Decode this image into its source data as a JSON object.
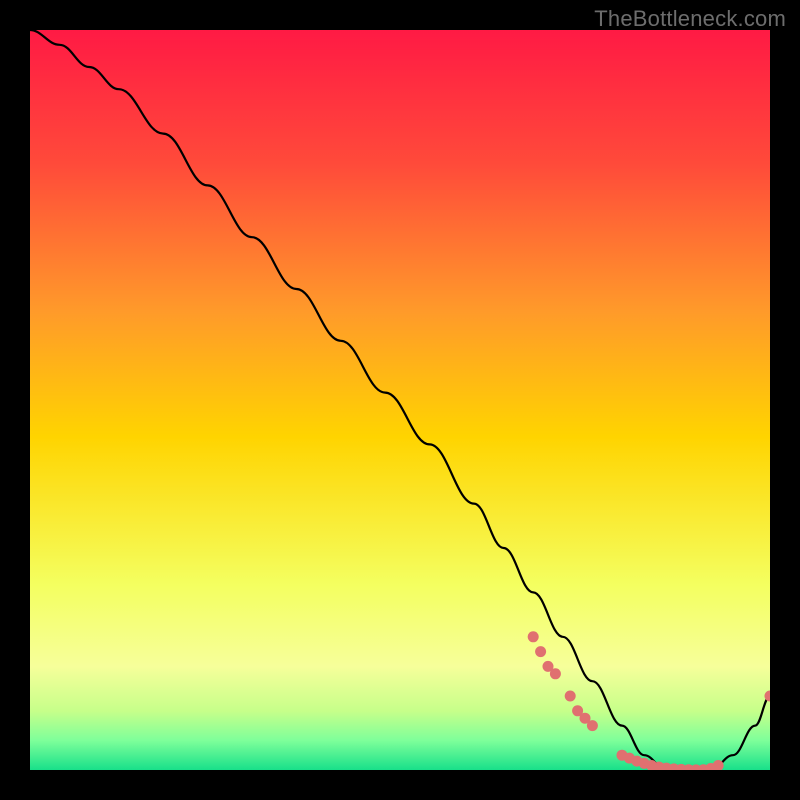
{
  "watermark": "TheBottleneck.com",
  "colors": {
    "curve": "#000000",
    "dot": "#e07070",
    "top": "#ff1a44",
    "mid": "#ffd400",
    "low1": "#f6ff9a",
    "low2": "#7eff9a",
    "bottom": "#18e08a"
  },
  "chart_data": {
    "type": "line",
    "title": "",
    "xlabel": "",
    "ylabel": "",
    "xlim": [
      0,
      100
    ],
    "ylim": [
      0,
      100
    ],
    "grid": false,
    "legend": false,
    "series": [
      {
        "name": "bottleneck-curve",
        "x": [
          0,
          4,
          8,
          12,
          18,
          24,
          30,
          36,
          42,
          48,
          54,
          60,
          64,
          68,
          72,
          76,
          80,
          83,
          86,
          89,
          92,
          95,
          98,
          100
        ],
        "y": [
          100,
          98,
          95,
          92,
          86,
          79,
          72,
          65,
          58,
          51,
          44,
          36,
          30,
          24,
          18,
          12,
          6,
          2,
          0,
          0,
          0,
          2,
          6,
          10
        ]
      }
    ],
    "points": [
      {
        "x": 68,
        "y": 18
      },
      {
        "x": 69,
        "y": 16
      },
      {
        "x": 70,
        "y": 14
      },
      {
        "x": 71,
        "y": 13
      },
      {
        "x": 73,
        "y": 10
      },
      {
        "x": 74,
        "y": 8
      },
      {
        "x": 75,
        "y": 7
      },
      {
        "x": 76,
        "y": 6
      },
      {
        "x": 80,
        "y": 2
      },
      {
        "x": 81,
        "y": 1.6
      },
      {
        "x": 82,
        "y": 1.2
      },
      {
        "x": 83,
        "y": 0.9
      },
      {
        "x": 84,
        "y": 0.6
      },
      {
        "x": 85,
        "y": 0.4
      },
      {
        "x": 86,
        "y": 0.25
      },
      {
        "x": 87,
        "y": 0.15
      },
      {
        "x": 88,
        "y": 0.08
      },
      {
        "x": 89,
        "y": 0.03
      },
      {
        "x": 90,
        "y": 0.01
      },
      {
        "x": 91,
        "y": 0.03
      },
      {
        "x": 92,
        "y": 0.2
      },
      {
        "x": 93,
        "y": 0.6
      },
      {
        "x": 100,
        "y": 10
      }
    ]
  }
}
